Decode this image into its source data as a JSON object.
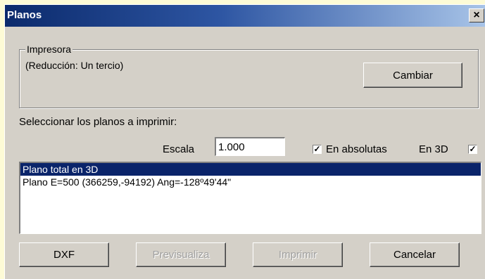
{
  "window": {
    "title": "Planos",
    "close_glyph": "×"
  },
  "printer": {
    "group_label": "Impresora",
    "status": "(Reducción: Un tercio)",
    "change_button": "Cambiar"
  },
  "selection": {
    "prompt": "Seleccionar los planos a imprimir:",
    "scale_label": "Escala",
    "scale_value": "1.000",
    "absolute_label": "En absolutas",
    "absolute_checked": true,
    "three_d_label": "En 3D",
    "three_d_checked": true
  },
  "plans": {
    "items": [
      {
        "label": "Plano total en 3D",
        "selected": true
      },
      {
        "label": "Plano E=500 (366259,-94192) Ang=-128º49'44\"",
        "selected": false
      }
    ]
  },
  "footer": {
    "dxf_button": "DXF",
    "preview_button": "Previsualiza",
    "print_button": "Imprimir",
    "cancel_button": "Cancelar"
  },
  "icons": {
    "check": "check-icon",
    "close": "close-icon"
  },
  "colors": {
    "dialog_bg": "#d4d0c8",
    "selection_bg": "#0a246a",
    "desktop_bg": "#fdfbd6"
  }
}
